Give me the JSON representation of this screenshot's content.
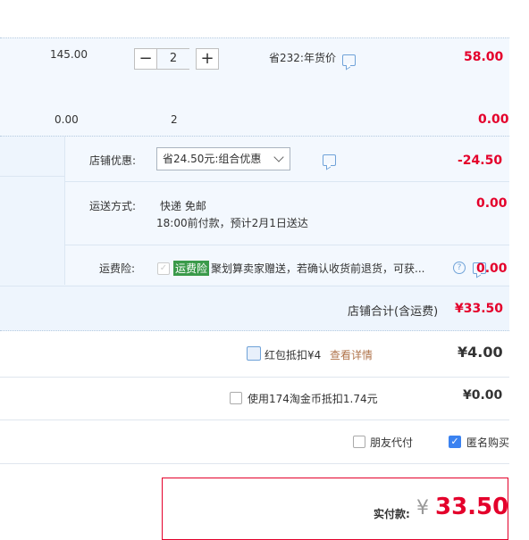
{
  "item1": {
    "unit_price": "145.00",
    "quantity": "2",
    "minus": "−",
    "plus": "+",
    "promo_text": "省232:年货价",
    "subtotal": "58.00"
  },
  "item2": {
    "unit_price": "0.00",
    "quantity": "2",
    "subtotal": "0.00"
  },
  "shop": {
    "discount_label": "店铺优惠:",
    "discount_select": "省24.50元:组合优惠",
    "discount_value": "-24.50",
    "shipping_label": "运送方式:",
    "shipping_method": "快递 免邮",
    "shipping_note": "18:00前付款，预计2月1日送达",
    "shipping_value": "0.00",
    "insurance_label": "运费险:",
    "insurance_tag": "运费险",
    "insurance_desc": "聚划算卖家赠送，若确认收货前退货，可获...",
    "insurance_value": "0.00",
    "total_label": "店铺合计(含运费)",
    "total_value": "¥33.50"
  },
  "payment": {
    "red_packet_label": "红包抵扣¥4",
    "red_packet_link": "查看详情",
    "red_packet_value": "¥4.00",
    "coins_label": "使用174淘金币抵扣1.74元",
    "coins_value": "¥0.00",
    "friend_pay": "朋友代付",
    "anonymous": "匿名购买",
    "actual_label": "实付款:",
    "currency": "¥",
    "actual_value": "33.50"
  },
  "colors": {
    "accent": "#e4002b",
    "link": "#b0744c",
    "blue_bg": "#f3f8fe"
  }
}
